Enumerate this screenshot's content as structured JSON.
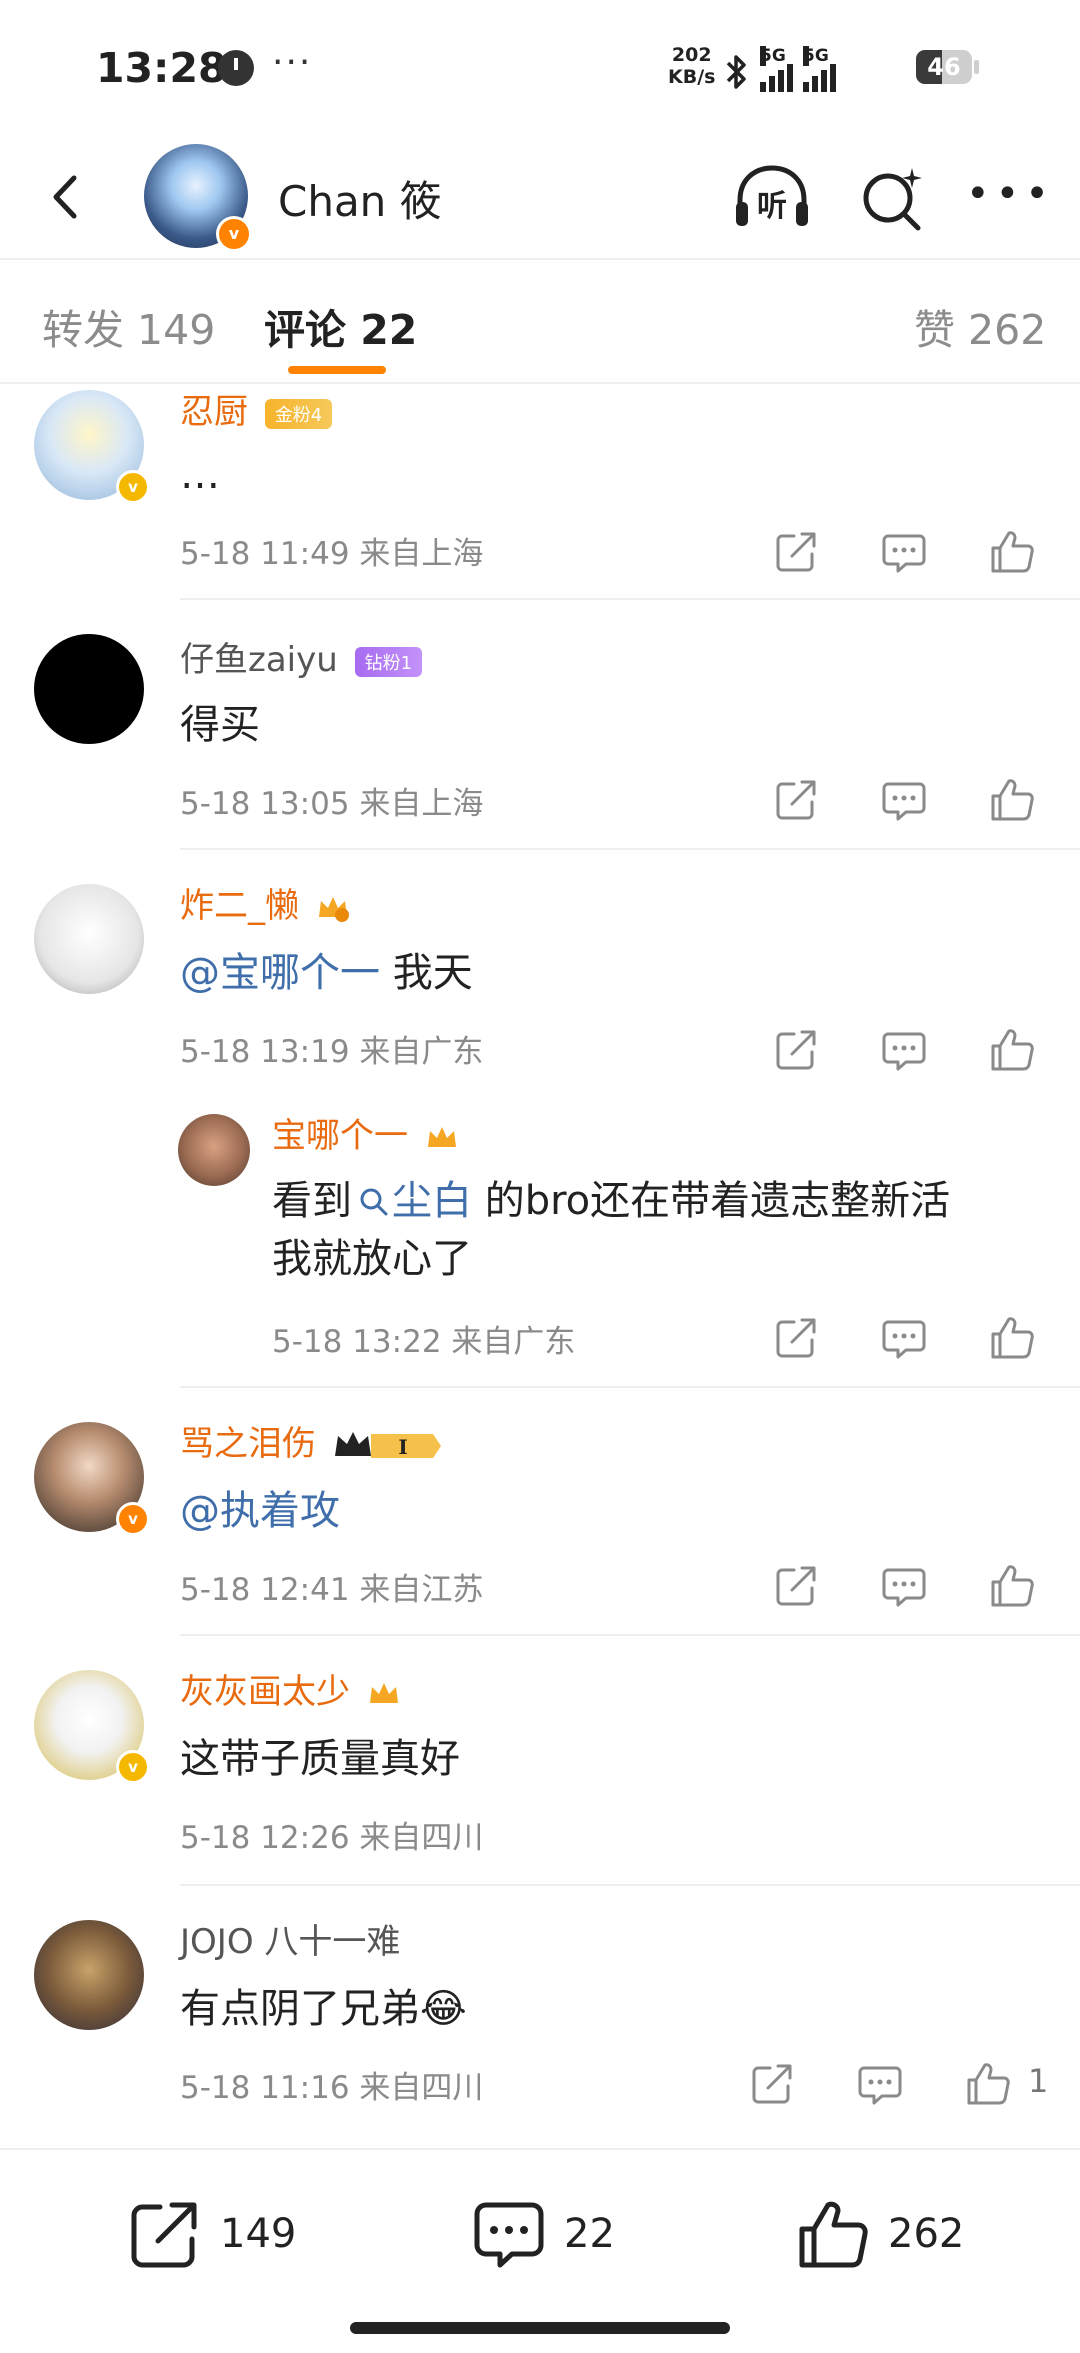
{
  "status": {
    "time": "13:28",
    "more": "···",
    "speed_top": "202",
    "speed_unit": "KB/s",
    "net1": "5G",
    "net2": "5G",
    "battery": "46",
    "battery_level": 0.46
  },
  "header": {
    "title": "Chan 筱",
    "listen_label": "听",
    "more": "•••"
  },
  "tabs": {
    "repost": "转发 149",
    "comments": "评论 22",
    "likes": "赞 262"
  },
  "comments": [
    {
      "name": "忍厨",
      "badge": "金粉4",
      "text": "…",
      "time": "5-18 11:49",
      "loc": "来自上海"
    },
    {
      "name": "仔鱼zaiyu",
      "badge": "钻粉1",
      "text": "得买",
      "time": "5-18 13:05",
      "loc": "来自上海"
    },
    {
      "name": "炸二_懒",
      "text_mention": "@宝哪个一",
      "text_rest": " 我天",
      "time": "5-18 13:19",
      "loc": "来自广东",
      "reply": {
        "name": "宝哪个一",
        "line1_pre": "看到",
        "line1_mention": "尘白",
        "line1_post": " 的bro还在带着遗志整新活",
        "line2": "我就放心了",
        "time": "5-18 13:22",
        "loc": "来自广东"
      }
    },
    {
      "name": "骂之泪伤",
      "text_mention": "@执着攻",
      "time": "5-18 12:41",
      "loc": "来自江苏"
    },
    {
      "name": "灰灰画太少",
      "text": "这带子质量真好",
      "time": "5-18 12:26",
      "loc": "来自四川"
    },
    {
      "name": "JOJO 八十一难",
      "text": "有点阴了兄弟😂",
      "time": "5-18 11:16",
      "loc": "来自四川",
      "likes": "1"
    }
  ],
  "bottom": {
    "repost": "149",
    "comment": "22",
    "like": "262"
  }
}
